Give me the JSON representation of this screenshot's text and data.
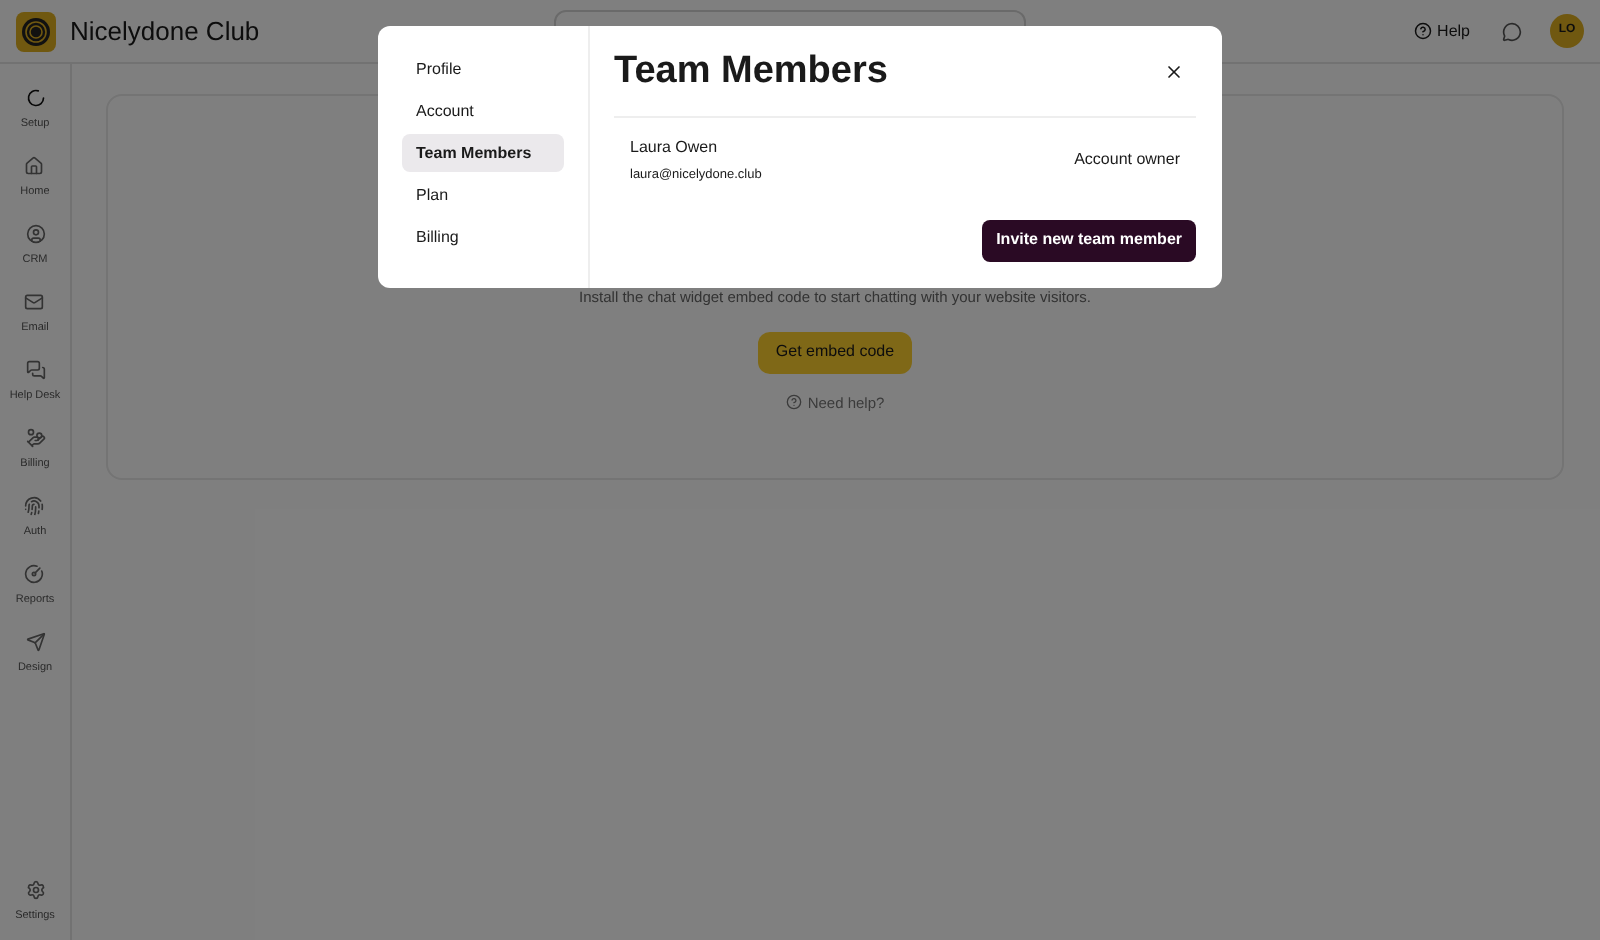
{
  "header": {
    "brand": "Nicelydone Club",
    "help": "Help",
    "avatar": "LO"
  },
  "sidebar": {
    "items": [
      {
        "label": "Setup"
      },
      {
        "label": "Home"
      },
      {
        "label": "CRM"
      },
      {
        "label": "Email"
      },
      {
        "label": "Help Desk"
      },
      {
        "label": "Billing"
      },
      {
        "label": "Auth"
      },
      {
        "label": "Reports"
      },
      {
        "label": "Design"
      }
    ],
    "settings": "Settings"
  },
  "card": {
    "text": "Install the chat widget embed code to start chatting with your website visitors.",
    "button": "Get embed code",
    "help_link": "Need help?"
  },
  "modal": {
    "nav": [
      {
        "label": "Profile",
        "selected": false
      },
      {
        "label": "Account",
        "selected": false
      },
      {
        "label": "Team Members",
        "selected": true
      },
      {
        "label": "Plan",
        "selected": false
      },
      {
        "label": "Billing",
        "selected": false
      }
    ],
    "title": "Team Members",
    "members": [
      {
        "name": "Laura Owen",
        "email": "laura@nicelydone.club",
        "role": "Account owner"
      }
    ],
    "invite_button": "Invite new team member"
  }
}
